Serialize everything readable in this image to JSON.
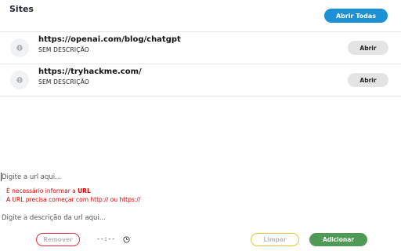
{
  "header": {
    "title": "Sites",
    "open_all_label": "Abrir Todas"
  },
  "sites": [
    {
      "url": "https://openai.com/blog/chatgpt",
      "description": "SEM DESCRIÇÃO",
      "open_label": "Abrir",
      "icon": "globe-icon"
    },
    {
      "url": "https://tryhackme.com/",
      "description": "SEM DESCRIÇÃO",
      "open_label": "Abrir",
      "icon": "globe-icon"
    }
  ],
  "form": {
    "url_placeholder": "Digite a url aqui...",
    "errors": {
      "required_prefix": "É necessário informar a ",
      "required_strong": "URL",
      "protocol": "A URL precisa começar com http:// ou https://"
    },
    "description_placeholder": "Digite a descrição da url aqui...",
    "time_value": "--:--",
    "remove_label": "Remover",
    "clear_label": "Limpar",
    "add_label": "Adicionar"
  },
  "colors": {
    "primary": "#1d91d6",
    "error": "#e00000",
    "remove_border": "#d9323a",
    "clear_border": "#e3c334",
    "add_bg": "#4f9a57"
  }
}
